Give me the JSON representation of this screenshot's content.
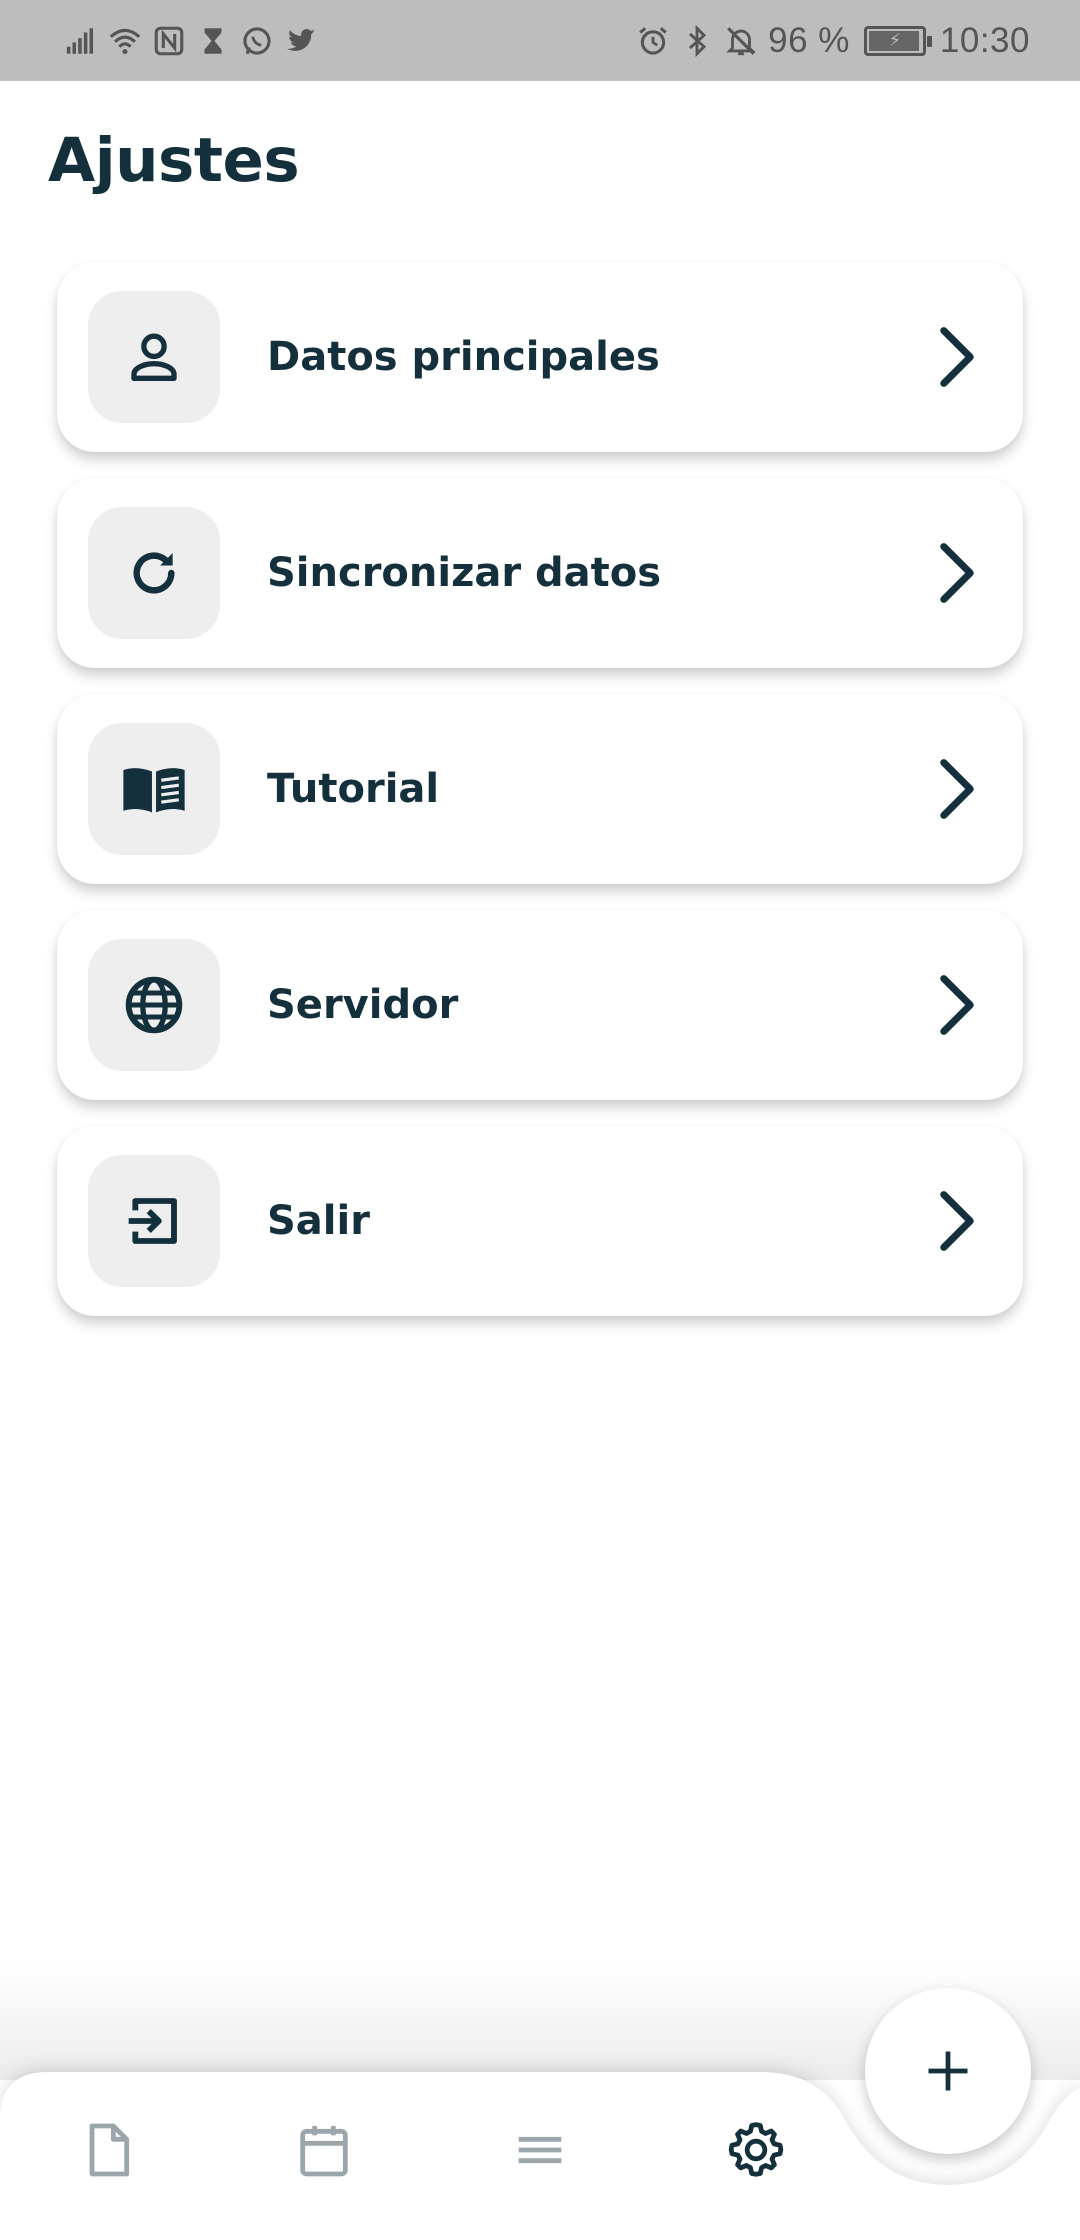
{
  "status_bar": {
    "left_icons": [
      "signal-icon",
      "wifi-icon",
      "nfc-icon",
      "hourglass-icon",
      "whatsapp-icon",
      "twitter-icon"
    ],
    "right_icons": [
      "alarm-icon",
      "bluetooth-icon",
      "bell-off-icon",
      "battery-icon"
    ],
    "battery_percent": "96 %",
    "battery_level": 0.96,
    "time": "10:30"
  },
  "page": {
    "title": "Ajustes"
  },
  "settings": {
    "items": [
      {
        "label": "Datos principales",
        "icon": "user-icon"
      },
      {
        "label": "Sincronizar datos",
        "icon": "refresh-icon"
      },
      {
        "label": "Tutorial",
        "icon": "book-icon"
      },
      {
        "label": "Servidor",
        "icon": "globe-icon"
      },
      {
        "label": "Salir",
        "icon": "logout-icon"
      }
    ]
  },
  "bottom_nav": {
    "items": [
      {
        "icon": "document-icon",
        "active": false
      },
      {
        "icon": "calendar-icon",
        "active": false
      },
      {
        "icon": "menu-icon",
        "active": false
      },
      {
        "icon": "gear-icon",
        "active": true
      }
    ],
    "fab_icon": "plus-icon"
  },
  "colors": {
    "primary_text": "#13303c",
    "inactive_nav": "#9aa6ab",
    "tile_background": "#eeeeee",
    "status_bar_background": "#bdbdbd"
  }
}
